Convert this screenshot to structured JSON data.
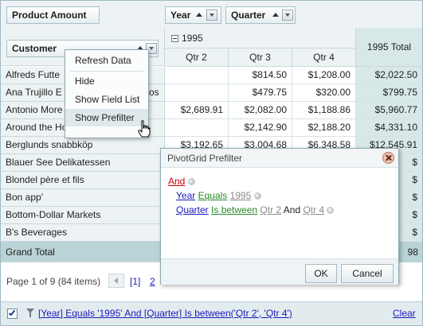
{
  "fields": {
    "data_field": "Product Amount",
    "col_field_1": "Year",
    "col_field_2": "Quarter",
    "row_field": "Customer"
  },
  "column_header": {
    "year": "1995",
    "quarters": [
      "Qtr 2",
      "Qtr 3",
      "Qtr 4"
    ],
    "total": "1995 Total"
  },
  "rows": [
    {
      "name": "Alfreds Futte",
      "values": [
        "",
        "$814.50",
        "$1,208.00"
      ],
      "total": "$2,022.50"
    },
    {
      "name": "Ana Trujillo E",
      "name_tail": "os",
      "values": [
        "",
        "$479.75",
        "$320.00"
      ],
      "total": "$799.75"
    },
    {
      "name": "Antonio More",
      "values": [
        "$2,689.91",
        "$2,082.00",
        "$1,188.86"
      ],
      "total": "$5,960.77"
    },
    {
      "name": "Around the Horn",
      "values": [
        "",
        "$2,142.90",
        "$2,188.20"
      ],
      "total": "$4,331.10"
    },
    {
      "name": "Berglunds snabbköp",
      "values": [
        "$3,192.65",
        "$3,004.68",
        "$6,348.58"
      ],
      "total": "$12,545.91"
    },
    {
      "name": "Blauer See Delikatessen",
      "values": [
        "",
        "",
        ""
      ],
      "total": "$"
    },
    {
      "name": "Blondel père et fils",
      "values": [
        "",
        "",
        ""
      ],
      "total": "$"
    },
    {
      "name": "Bon app'",
      "values": [
        "",
        "",
        ""
      ],
      "total": "$"
    },
    {
      "name": "Bottom-Dollar Markets",
      "values": [
        "",
        "",
        ""
      ],
      "total": "$"
    },
    {
      "name": "B's Beverages",
      "values": [
        "",
        "",
        ""
      ],
      "total": "$"
    }
  ],
  "grand_total": {
    "label": "Grand Total",
    "total": "98"
  },
  "context_menu": [
    "Refresh Data",
    "Hide",
    "Show Field List",
    "Show Prefilter"
  ],
  "dialog": {
    "title": "PivotGrid Prefilter",
    "group_op": "And",
    "cond1": {
      "field": "Year",
      "op": "Equals",
      "value": "1995"
    },
    "cond2": {
      "field": "Quarter",
      "op": "Is between",
      "v1": "Qtr 2",
      "and": "And",
      "v2": "Qtr 4"
    },
    "ok": "OK",
    "cancel": "Cancel"
  },
  "pager": {
    "summary": "Page 1 of 9 (84 items)",
    "current": "[1]",
    "next": "2"
  },
  "status": {
    "filter_text": "[Year] Equals '1995' And [Quarter] Is between('Qtr 2', 'Qtr 4')",
    "clear": "Clear"
  },
  "icons": [
    "sort-ascending-icon",
    "filter-dropdown-icon",
    "collapse-icon",
    "close-icon",
    "add-condition-icon",
    "remove-condition-icon",
    "filter-icon",
    "checkbox-icon",
    "hand-cursor-icon",
    "pager-prev-icon"
  ],
  "colors": {
    "accent": "#1a1ab8",
    "header_bg": "#edf3f4",
    "total_bg": "#d8e8e8",
    "status_bg": "#e2ecef",
    "grand_total_bg": "#b9d3d6"
  }
}
